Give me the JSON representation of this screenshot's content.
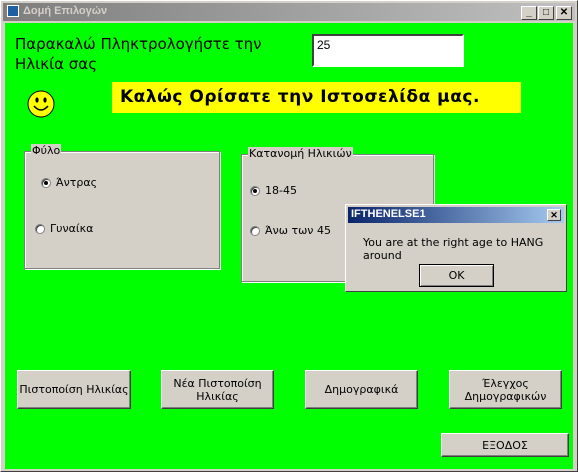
{
  "window": {
    "title": "Δομή Επιλογών",
    "minimize": "_",
    "maximize": "□",
    "close": "✕"
  },
  "form": {
    "prompt_line1": "Παρακαλώ Πληκτρολογήστε την",
    "prompt_line2": "Ηλικία σας",
    "age_value": "25",
    "welcome": "Καλώς Ορίσατε την Ιστοσελίδα μας.",
    "smiley_icon": "smiley-face-icon",
    "gender_frame": {
      "label": "Φύλο",
      "options": [
        {
          "label": "Άντρας",
          "selected": true
        },
        {
          "label": "Γυναίκα",
          "selected": false
        }
      ]
    },
    "age_frame": {
      "label": "Κατανομή Ηλικιών",
      "options": [
        {
          "label": "18-45",
          "selected": true
        },
        {
          "label": "Άνω των 45",
          "selected": false
        }
      ]
    },
    "buttons": {
      "verify_age": "Πιστοποίση Ηλικίας",
      "new_verify_line1": "Νέα Πιστοποίση",
      "new_verify_line2": "Ηλικίας",
      "demographics": "Δημογραφικά",
      "check_demo_line1": "Έλεγχος",
      "check_demo_line2": "Δημογραφικών",
      "exit": "ΕΞΟΔΟΣ"
    }
  },
  "dialog": {
    "title": "IFTHENELSE1",
    "close": "✕",
    "message": "You are at the right age to HANG around",
    "ok": "OK"
  }
}
